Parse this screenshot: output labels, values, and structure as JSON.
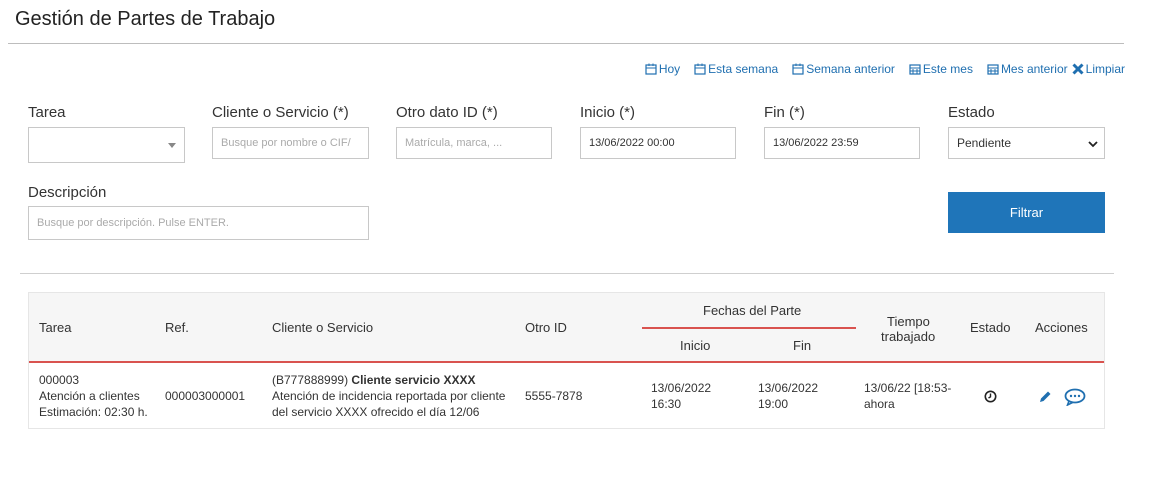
{
  "page": {
    "title": "Gestión de Partes de Trabajo"
  },
  "quick_filters": [
    {
      "label": "Hoy",
      "icon": "calendar-icon"
    },
    {
      "label": "Esta semana",
      "icon": "calendar-icon"
    },
    {
      "label": "Semana anterior",
      "icon": "calendar-icon"
    },
    {
      "label": "Este mes",
      "icon": "calendar-icon"
    },
    {
      "label": "Mes anterior",
      "icon": "calendar-icon"
    },
    {
      "label": "Limpiar",
      "icon": "close-icon"
    }
  ],
  "filters": {
    "tarea": {
      "label": "Tarea",
      "value": ""
    },
    "cliente": {
      "label": "Cliente o Servicio (*)",
      "placeholder": "Busque por nombre o CIF/"
    },
    "otro_dato": {
      "label": "Otro dato ID (*)",
      "placeholder": "Matrícula, marca, ..."
    },
    "inicio": {
      "label": "Inicio (*)",
      "value": "13/06/2022 00:00"
    },
    "fin": {
      "label": "Fin (*)",
      "value": "13/06/2022 23:59"
    },
    "estado": {
      "label": "Estado",
      "value": "Pendiente"
    },
    "descripcion": {
      "label": "Descripción",
      "placeholder": "Busque por descripción. Pulse ENTER."
    },
    "filter_button": "Filtrar"
  },
  "table": {
    "headers": {
      "tarea": "Tarea",
      "ref": "Ref.",
      "cliente": "Cliente o Servicio",
      "otro_id": "Otro ID",
      "fechas": "Fechas del Parte",
      "inicio": "Inicio",
      "fin": "Fin",
      "tiempo_l1": "Tiempo",
      "tiempo_l2": "trabajado",
      "estado": "Estado",
      "acciones": "Acciones"
    },
    "rows": [
      {
        "tarea_code": "000003",
        "tarea_name": "Atención a clientes",
        "tarea_estimacion": "Estimación: 02:30 h.",
        "ref": "000003000001",
        "cliente_cif": "(B777888999)",
        "cliente_name": "Cliente servicio XXXX",
        "cliente_desc_l1": "Atención de incidencia reportada por cliente",
        "cliente_desc_l2": "del servicio XXXX ofrecido el día 12/06",
        "otro_id": "5555-7878",
        "inicio_date": "13/06/2022",
        "inicio_time": "16:30",
        "fin_date": "13/06/2022",
        "fin_time": "19:00",
        "tiempo_l1": "13/06/22 [18:53-",
        "tiempo_l2": "ahora",
        "estado_icon": "clock-icon",
        "actions": [
          "pencil-icon",
          "comment-icon"
        ]
      }
    ]
  },
  "colors": {
    "accent": "#1f75b9",
    "link": "#1f6fb0",
    "divider": "#d9534f"
  }
}
